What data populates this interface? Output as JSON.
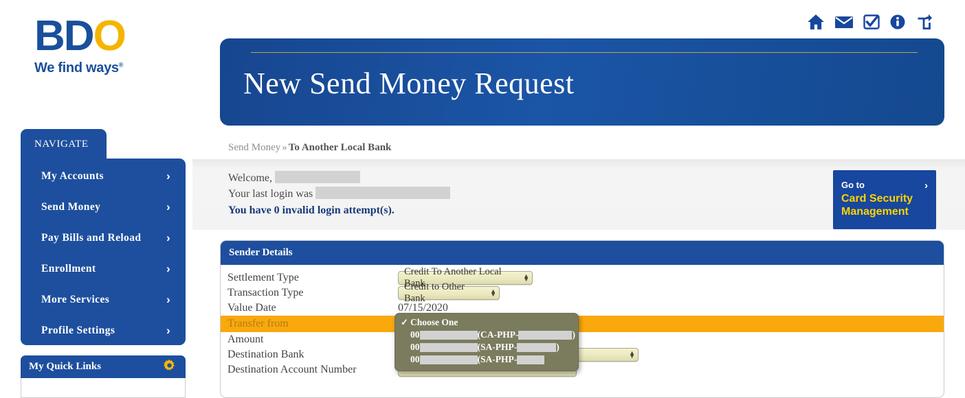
{
  "brand": {
    "logo_b": "B",
    "logo_d": "D",
    "logo_o": "O",
    "tagline": "We find ways",
    "tagline_mark": "®",
    "blue": "#1a4f9c",
    "gold": "#f5b400"
  },
  "top_icons": [
    {
      "name": "home-icon",
      "label": "Home"
    },
    {
      "name": "mail-icon",
      "label": "Messages"
    },
    {
      "name": "check-square-icon",
      "label": "Tasks"
    },
    {
      "name": "info-circle-icon",
      "label": "Information"
    },
    {
      "name": "share-icon",
      "label": "Share"
    }
  ],
  "header": {
    "title": "New Send Money Request"
  },
  "breadcrumb": {
    "parent": "Send Money",
    "separator": "»",
    "current": "To Another Local Bank"
  },
  "welcome": {
    "greeting": "Welcome,",
    "name_redacted": "",
    "last_login_label": "Your last login was",
    "last_login_redacted": "",
    "invalid_attempts": "You have 0 invalid login attempt(s)."
  },
  "promo": {
    "pretitle": "Go to",
    "title_line1": "Card Security",
    "title_line2": "Management",
    "arrow": "›"
  },
  "sidebar": {
    "header": "NAVIGATE",
    "items": [
      {
        "label": "My Accounts",
        "chevron": "›"
      },
      {
        "label": "Send Money",
        "chevron": "›"
      },
      {
        "label": "Pay Bills and Reload",
        "chevron": "›"
      },
      {
        "label": "Enrollment",
        "chevron": "›"
      },
      {
        "label": "More Services",
        "chevron": "›"
      },
      {
        "label": "Profile Settings",
        "chevron": "›"
      }
    ],
    "quick_links": {
      "title": "My Quick Links",
      "gear_icon": "gear-icon"
    }
  },
  "form": {
    "panel_title": "Sender Details",
    "rows": [
      {
        "label": "Settlement Type",
        "value": "Credit To Another Local Bank",
        "control": "select"
      },
      {
        "label": "Transaction Type",
        "value": "Credit to Other Bank",
        "control": "select"
      },
      {
        "label": "Value Date",
        "value": "07/15/2020",
        "control": "text"
      },
      {
        "label": "Transfer from",
        "value": "",
        "control": "select",
        "highlighted": true
      },
      {
        "label": "Amount",
        "value": "",
        "control": "select"
      },
      {
        "label": "Destination Bank",
        "value": "",
        "control": "select"
      },
      {
        "label": "Destination Account Number",
        "value": "",
        "control": "select"
      }
    ],
    "stepper_up": "▲",
    "stepper_down": "▼"
  },
  "dropdown": {
    "open": true,
    "selected_index": 0,
    "check_glyph": "✓",
    "options": [
      {
        "text": "Choose One",
        "checked": true
      },
      {
        "prefix": "00",
        "type": "(CA-PHP-",
        "suffix": ")",
        "redacted": true
      },
      {
        "prefix": "00",
        "type": "(SA-PHP-",
        "suffix": ")",
        "redacted": true
      },
      {
        "prefix": "00",
        "type": "(SA-PHP-",
        "suffix": "",
        "redacted": true
      }
    ]
  },
  "colors": {
    "brand_blue": "#1d4f9e",
    "banner_blue": "#17468f",
    "highlight_orange": "#f9a90c",
    "select_cream": "#ebe9c0",
    "dropdown_olive": "#7b7b5e",
    "promo_yellow": "#ffd400"
  }
}
